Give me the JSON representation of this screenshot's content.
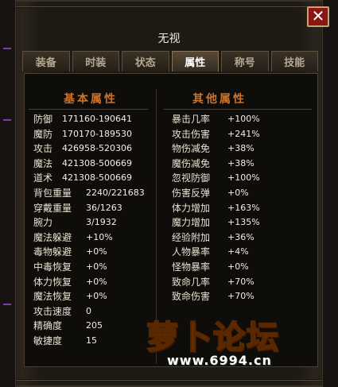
{
  "window": {
    "title": "无视",
    "close_label": "✕"
  },
  "tabs": [
    {
      "label": "装备",
      "active": false
    },
    {
      "label": "时装",
      "active": false
    },
    {
      "label": "状态",
      "active": false
    },
    {
      "label": "属性",
      "active": true
    },
    {
      "label": "称号",
      "active": false
    },
    {
      "label": "技能",
      "active": false
    }
  ],
  "sections": {
    "basic": "基本属性",
    "other": "其他属性"
  },
  "basic_stats": [
    {
      "label": "防御",
      "value": "171160-190641"
    },
    {
      "label": "魔防",
      "value": "170170-189530"
    },
    {
      "label": "攻击",
      "value": "426958-520306"
    },
    {
      "label": "魔法",
      "value": "421308-500669"
    },
    {
      "label": "道术",
      "value": "421308-500669"
    },
    {
      "label": "背包重量",
      "value": "2240/221683"
    },
    {
      "label": "穿戴重量",
      "value": "36/1263"
    },
    {
      "label": "腕力",
      "value": "3/1932"
    },
    {
      "label": "魔法躲避",
      "value": "+10%"
    },
    {
      "label": "毒物躲避",
      "value": "+0%"
    },
    {
      "label": "中毒恢复",
      "value": "+0%"
    },
    {
      "label": "体力恢复",
      "value": "+0%"
    },
    {
      "label": "魔法恢复",
      "value": "+0%"
    },
    {
      "label": "攻击速度",
      "value": "0"
    },
    {
      "label": "精确度",
      "value": "205"
    },
    {
      "label": "敏捷度",
      "value": "15"
    }
  ],
  "other_stats": [
    {
      "label": "暴击几率",
      "value": "+100%"
    },
    {
      "label": "攻击伤害",
      "value": "+241%"
    },
    {
      "label": "物伤减免",
      "value": "+38%"
    },
    {
      "label": "魔伤减免",
      "value": "+38%"
    },
    {
      "label": "忽视防御",
      "value": "+100%"
    },
    {
      "label": "伤害反弹",
      "value": "+0%"
    },
    {
      "label": "体力增加",
      "value": "+163%"
    },
    {
      "label": "魔力增加",
      "value": "+135%"
    },
    {
      "label": "经验附加",
      "value": "+36%"
    },
    {
      "label": "人物暴率",
      "value": "+4%"
    },
    {
      "label": "怪物暴率",
      "value": "+0%"
    },
    {
      "label": "致命几率",
      "value": "+70%"
    },
    {
      "label": "致命伤害",
      "value": "+70%"
    }
  ],
  "watermark": {
    "name": "萝卜论坛",
    "url": "www.6994.cn"
  }
}
